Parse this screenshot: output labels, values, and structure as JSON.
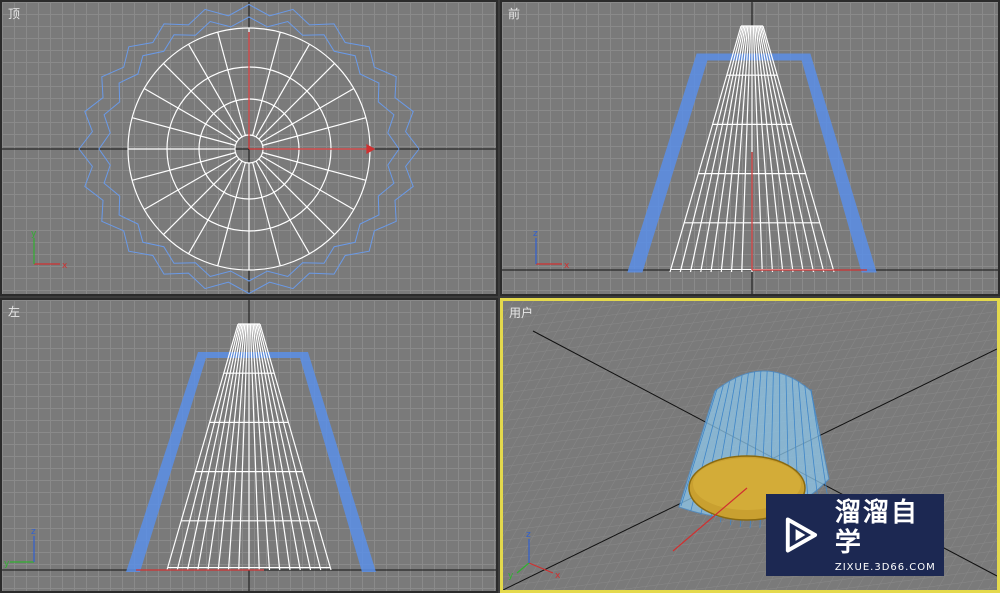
{
  "viewports": {
    "top": {
      "label": "顶"
    },
    "front": {
      "label": "前"
    },
    "left": {
      "label": "左"
    },
    "user": {
      "label": "用户",
      "active": true
    }
  },
  "axes": {
    "x": "x",
    "y": "y",
    "z": "z"
  },
  "colors": {
    "viewport_bg": "#7a7a7a",
    "grid": "#8a8a8a",
    "wire_white": "#ffffff",
    "wire_blue": "#5b8fe8",
    "active_border": "#e4d94c",
    "gizmo_red": "#d03030",
    "disk_gold": "#c9a030"
  },
  "watermark": {
    "title": "溜溜自学",
    "url": "ZIXUE.3D66.COM",
    "logo_icon": "play-icon"
  }
}
